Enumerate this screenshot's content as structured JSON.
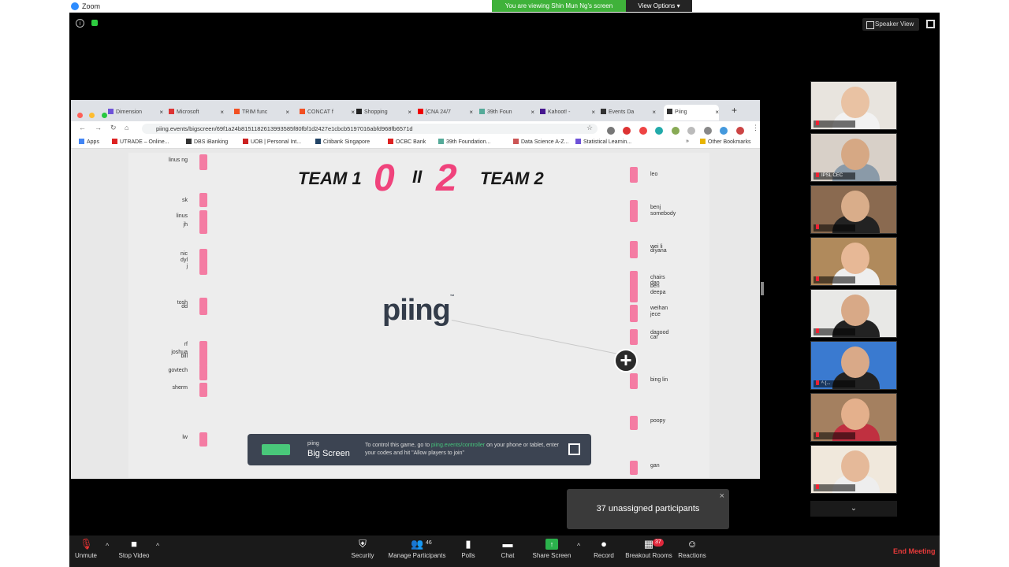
{
  "window": {
    "app_title": "Zoom"
  },
  "banner": {
    "viewing": "You are viewing Shin Mun Ng's screen",
    "view_options": "View Options ▾"
  },
  "top": {
    "speaker_view": "Speaker View"
  },
  "browser": {
    "tabs": [
      {
        "label": "Dimension",
        "favicon_color": "#6e52d8"
      },
      {
        "label": "Microsoft",
        "favicon_color": "#d33"
      },
      {
        "label": "TRIM func",
        "favicon_color": "#f25022"
      },
      {
        "label": "CONCAT f",
        "favicon_color": "#f25022"
      },
      {
        "label": "Shopping",
        "favicon_color": "#222"
      },
      {
        "label": "[CNA 24/7",
        "favicon_color": "#e00"
      },
      {
        "label": "39th Foun",
        "favicon_color": "#5a9"
      },
      {
        "label": "Kahoot! -",
        "favicon_color": "#46178f"
      },
      {
        "label": "Events Da",
        "favicon_color": "#333"
      },
      {
        "label": "Piing",
        "favicon_color": "#333"
      }
    ],
    "new_tab": "+",
    "url": "piing.events/bigscreen/69f1a24b8151182613993585f80fbf1d2427e1cbcb5197016abfd968fb6571d",
    "bookmarks": [
      {
        "label": "Apps",
        "color": "#4285f4"
      },
      {
        "label": "UTRADE – Online...",
        "color": "#d22"
      },
      {
        "label": "DBS iBanking",
        "color": "#333"
      },
      {
        "label": "UOB | Personal Int...",
        "color": "#c22"
      },
      {
        "label": "Citibank Singapore",
        "color": "#246"
      },
      {
        "label": "OCBC Bank",
        "color": "#d22"
      },
      {
        "label": "39th Foundation...",
        "color": "#5a9"
      },
      {
        "label": "Data Science A-Z...",
        "color": "#c55"
      },
      {
        "label": "Statistical Learnin...",
        "color": "#6e52d8"
      },
      {
        "label": "»",
        "color": "#fff"
      },
      {
        "label": "Other Bookmarks",
        "color": "#e8b400"
      }
    ]
  },
  "game": {
    "team1": "TEAM 1",
    "team2": "TEAM 2",
    "score1": "0",
    "score2": "2",
    "separator": "II",
    "logo": "piing",
    "logo_tm": "™",
    "left_players": [
      "linus ng",
      "sk",
      "linus",
      "jh",
      "nic",
      "dyl",
      "j",
      "tosh",
      "dd",
      "rf",
      "joshua",
      "bill",
      "govtech",
      "sherm",
      "lw"
    ],
    "right_players": [
      "leo",
      "benj",
      "somebody",
      "wei li",
      "diyana",
      "chairs",
      "dan",
      "ben",
      "deepa",
      "weihan",
      "jece",
      "dagood",
      "car",
      "bing lin",
      "poopy",
      "gan"
    ],
    "banner_small": "piing",
    "banner_title": "Big Screen",
    "banner_text_1": "To control this game, go to ",
    "banner_link": "piing.events/controller",
    "banner_text_2": " on your phone or tablet, enter your codes and hit \"Allow players to join\"",
    "plus": "+"
  },
  "thumbnails": [
    {
      "name": "",
      "bg": "#e8e4de",
      "skin": "#e9c2a3",
      "shirt": "#f2f2f2"
    },
    {
      "name": "IPSL CEC",
      "bg": "#d8d0c8",
      "skin": "#d6a884",
      "shirt": "#8a9aa8"
    },
    {
      "name": "",
      "bg": "#8a6a50",
      "skin": "#d9ad8a",
      "shirt": "#222"
    },
    {
      "name": "",
      "bg": "#b08a5c",
      "skin": "#e7b896",
      "shirt": "#eee"
    },
    {
      "name": "",
      "bg": "#e8e8e6",
      "skin": "#d8a987",
      "shirt": "#222"
    },
    {
      "name": "ᴬ (...",
      "bg": "#3a7ad0",
      "skin": "#d9a988",
      "shirt": "#222"
    },
    {
      "name": "",
      "bg": "#a48060",
      "skin": "#e4b08c",
      "shirt": "#c03040"
    },
    {
      "name": "",
      "bg": "#f0e8dc",
      "skin": "#e5b999",
      "shirt": "#eee"
    }
  ],
  "thumb_down": "⌄",
  "toast": {
    "text": "37 unassigned participants",
    "close": "×"
  },
  "toolbar": {
    "unmute": "Unmute",
    "stop_video": "Stop Video",
    "security": "Security",
    "manage_participants": "Manage Participants",
    "participants_count": "46",
    "polls": "Polls",
    "chat": "Chat",
    "share_screen": "Share Screen",
    "record": "Record",
    "breakout_rooms": "Breakout Rooms",
    "breakout_badge": "37",
    "reactions": "Reactions",
    "end_meeting": "End Meeting",
    "caret": "^"
  }
}
